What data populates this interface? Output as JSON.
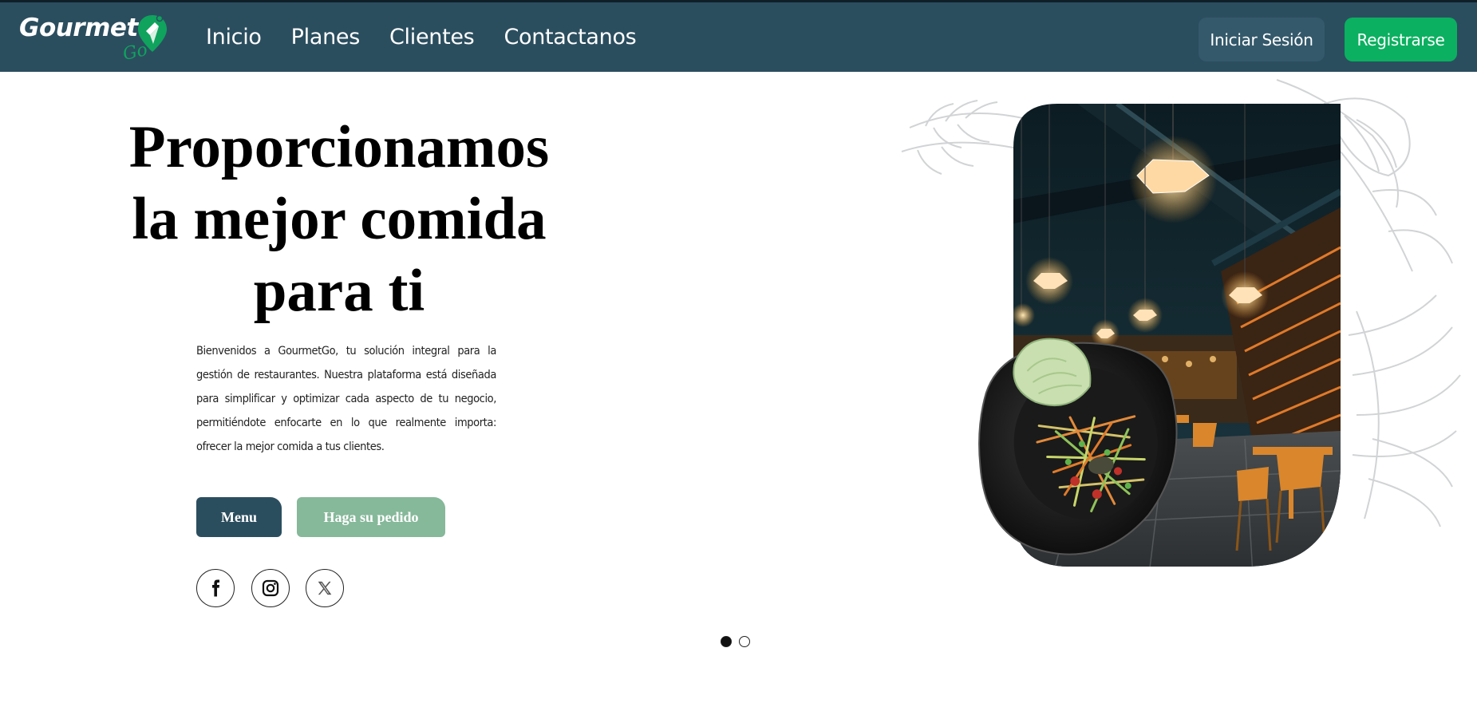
{
  "brand": {
    "name": "Gourmet",
    "suffix": "Go",
    "accent_color": "#0fa35e",
    "nav_bg": "#2b4e5f"
  },
  "nav": {
    "links": [
      "Inicio",
      "Planes",
      "Clientes",
      "Contactanos"
    ],
    "login_label": "Iniciar Sesión",
    "register_label": "Registrarse"
  },
  "hero": {
    "title_lines": [
      "Proporcionamos",
      "la mejor comida",
      "para ti"
    ],
    "description": "Bienvenidos a GourmetGo, tu solución integral para la gestión de restaurantes. Nuestra plataforma está diseñada para simplificar y optimizar cada aspecto de tu negocio, permitiéndote enfocarte en lo que realmente importa: ofrecer la mejor comida a tus clientes.",
    "menu_button": "Menu",
    "order_button": "Haga su pedido",
    "order_button_color": "#86b89a"
  },
  "social": {
    "icons": [
      "facebook-icon",
      "instagram-icon",
      "x-twitter-icon"
    ]
  },
  "carousel": {
    "slides": 2,
    "active_index": 0
  },
  "images": {
    "restaurant": "dark restaurant interior with hanging lamps and orange chairs",
    "dish": "black plate with papaya salad and lettuce"
  }
}
